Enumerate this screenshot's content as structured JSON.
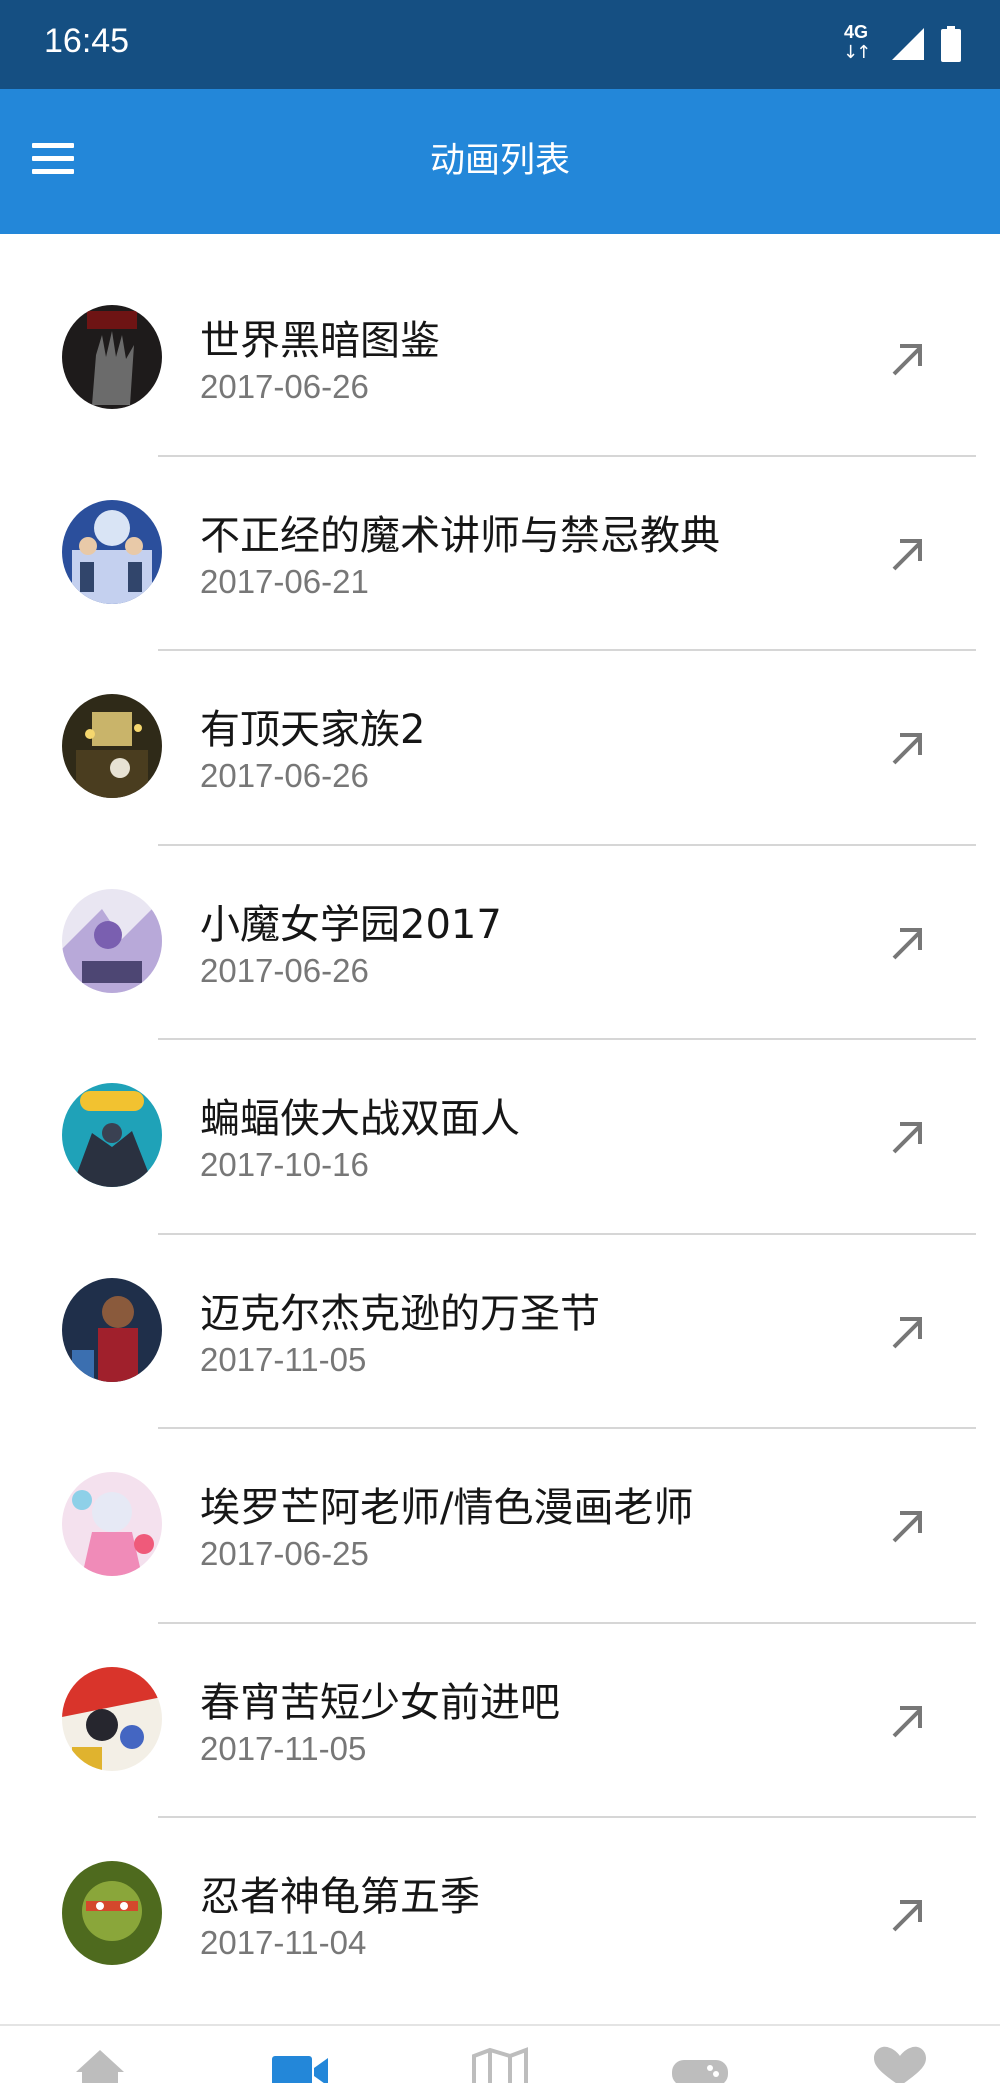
{
  "status_bar": {
    "time": "16:45",
    "network": "4G",
    "icons": [
      "network-4g-icon",
      "signal-icon",
      "battery-icon"
    ]
  },
  "app_bar": {
    "title": "动画列表",
    "menu_icon": "menu-icon",
    "color": "#2387d9"
  },
  "anime_list": [
    {
      "title": "世界黑暗图鉴",
      "date": "2017-06-26"
    },
    {
      "title": "不正经的魔术讲师与禁忌教典",
      "date": "2017-06-21"
    },
    {
      "title": "有顶天家族2",
      "date": "2017-06-26"
    },
    {
      "title": "小魔女学园2017",
      "date": "2017-06-26"
    },
    {
      "title": "蝙蝠侠大战双面人",
      "date": "2017-10-16"
    },
    {
      "title": "迈克尔杰克逊的万圣节",
      "date": "2017-11-05"
    },
    {
      "title": "埃罗芒阿老师/情色漫画老师",
      "date": "2017-06-25"
    },
    {
      "title": "春宵苦短少女前进吧",
      "date": "2017-11-05"
    },
    {
      "title": "忍者神龟第五季",
      "date": "2017-11-04"
    }
  ],
  "bottom_nav": {
    "tabs": [
      "home-icon",
      "video-icon",
      "book-icon",
      "gamepad-icon",
      "heart-icon"
    ],
    "active_tab": "video-icon",
    "active_color": "#2387d9",
    "inactive_color": "#bdbdbd"
  }
}
